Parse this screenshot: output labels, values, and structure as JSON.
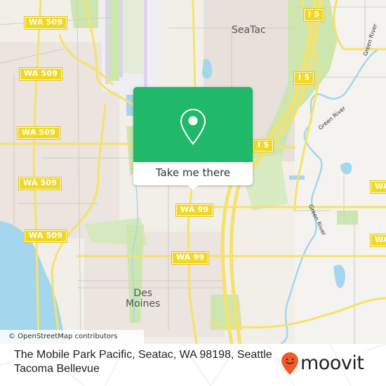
{
  "map": {
    "places": {
      "seatac": "SeaTac",
      "des_moines": "Des\nMoines"
    },
    "shields": [
      {
        "id": "wa509-1",
        "label": "WA 509"
      },
      {
        "id": "wa509-2",
        "label": "WA 509"
      },
      {
        "id": "wa509-3",
        "label": "WA 509"
      },
      {
        "id": "wa509-4",
        "label": "WA 509"
      },
      {
        "id": "wa509-5",
        "label": "WA 509"
      },
      {
        "id": "i5-1",
        "label": "I 5"
      },
      {
        "id": "i5-2",
        "label": "I 5"
      },
      {
        "id": "i5-3",
        "label": "I 5"
      },
      {
        "id": "wa99-1",
        "label": "WA 99"
      },
      {
        "id": "wa99-2",
        "label": "WA 99"
      },
      {
        "id": "wa-east-1",
        "label": "WA"
      },
      {
        "id": "wa-east-2",
        "label": "WA"
      }
    ],
    "rivers": {
      "green_river_1": "Green River",
      "green_river_2": "Green River",
      "green_river_3": "Green River"
    },
    "attribution": "© OpenStreetMap contributors",
    "colors": {
      "land": "#f2efe9",
      "water": "#a4d6ee",
      "park": "#cde6b0",
      "road_major": "#f5e26a",
      "shield": "#f0d824"
    }
  },
  "popup": {
    "icon": "map-pin-icon",
    "button_label": "Take me there",
    "color": "#20b96a"
  },
  "footer": {
    "address": "The Mobile Park Pacific, Seatac, WA 98198, Seattle Tacoma Bellevue",
    "brand": "moovit",
    "brand_color": "#f15a29"
  }
}
